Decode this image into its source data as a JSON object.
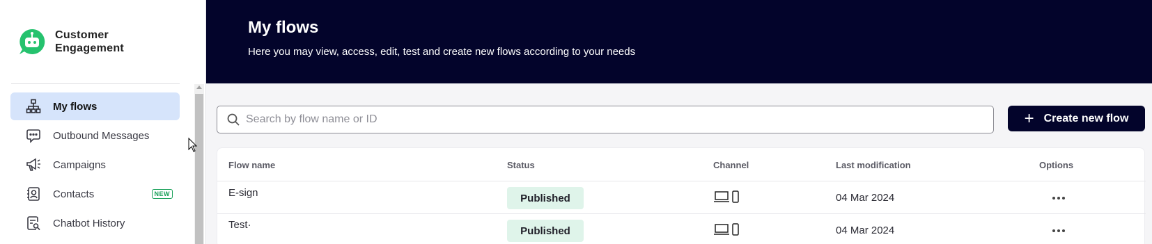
{
  "brand": {
    "line1": "Customer",
    "line2": "Engagement",
    "logo_icon": "chatbot-icon",
    "color": "#25c26e"
  },
  "sidebar": {
    "items": [
      {
        "label": "My flows",
        "icon": "sitemap-icon",
        "active": true
      },
      {
        "label": "Outbound Messages",
        "icon": "message-icon"
      },
      {
        "label": "Campaigns",
        "icon": "megaphone-icon"
      },
      {
        "label": "Contacts",
        "icon": "contacts-icon",
        "badge": "NEW"
      },
      {
        "label": "Chatbot History",
        "icon": "history-icon"
      }
    ]
  },
  "header": {
    "title": "My flows",
    "subtitle": "Here you may view, access, edit, test and create new flows according to your needs"
  },
  "search": {
    "placeholder": "Search by flow name or ID",
    "value": ""
  },
  "actions": {
    "create_label": "Create new flow"
  },
  "table": {
    "columns": [
      "Flow name",
      "Status",
      "Channel",
      "Last modification",
      "Options"
    ],
    "rows": [
      {
        "name": "E-sign",
        "status": "Published",
        "channel": [
          "desktop-icon",
          "mobile-icon"
        ],
        "date": "04 Mar 2024"
      },
      {
        "name": "Test·",
        "status": "Published",
        "channel": [
          "desktop-icon",
          "mobile-icon"
        ],
        "date": "04 Mar 2024"
      }
    ]
  },
  "colors": {
    "header_bg": "#03042b",
    "active_nav": "#d6e4fb",
    "published_bg": "#dff4ea",
    "new_badge": "#18a058"
  }
}
